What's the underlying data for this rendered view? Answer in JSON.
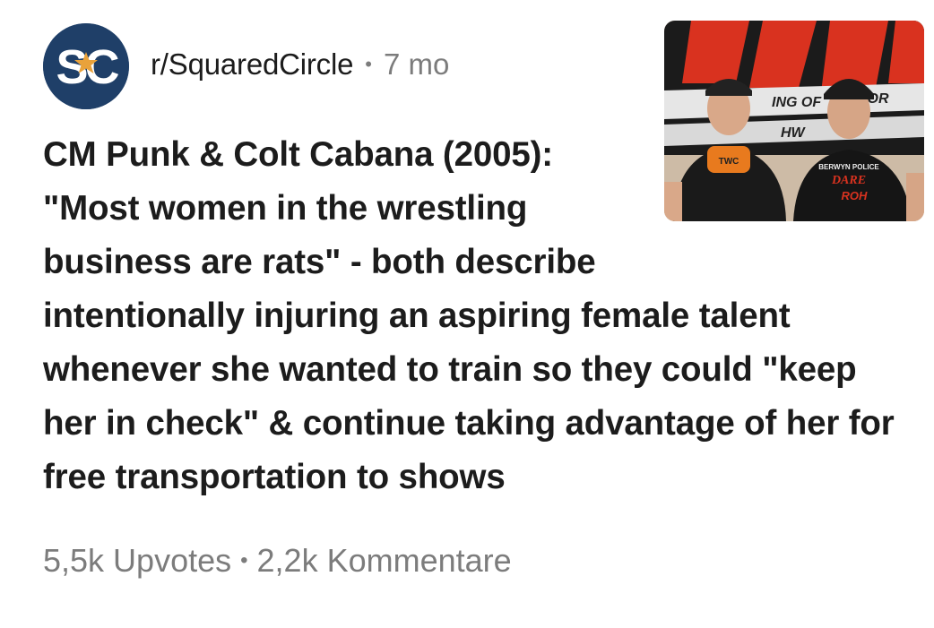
{
  "community": {
    "name": "r/SquaredCircle",
    "age": "7 mo",
    "avatar_text": "SC",
    "avatar_icon": "star-icon",
    "avatar_color": "#1f3f68",
    "avatar_accent": "#e9a23b"
  },
  "thumbnail": {
    "banner_text_1": "ING OF",
    "banner_text_2": "NOR",
    "banner_text_3": "HW",
    "shirt_left": "TWC",
    "shirt_right_1": "BERWYN POLICE",
    "shirt_right_2": "DARE",
    "shirt_right_3": "ROH"
  },
  "post": {
    "title_lines": [
      "CM Punk & Colt Cabana (2005):",
      "\"Most women in the wrestling",
      "business are rats\" - both describe",
      "intentionally injuring an aspiring female talent",
      "whenever she wanted to train so they could \"keep",
      "her in check\" & continue taking advantage of her for",
      "free transportation to shows"
    ]
  },
  "stats": {
    "upvotes": "5,5k Upvotes",
    "separator": "•",
    "comments": "2,2k Kommentare"
  },
  "colors": {
    "text_primary": "#1c1c1c",
    "text_secondary": "#7c7c7c",
    "banner_red": "#d9321f"
  }
}
